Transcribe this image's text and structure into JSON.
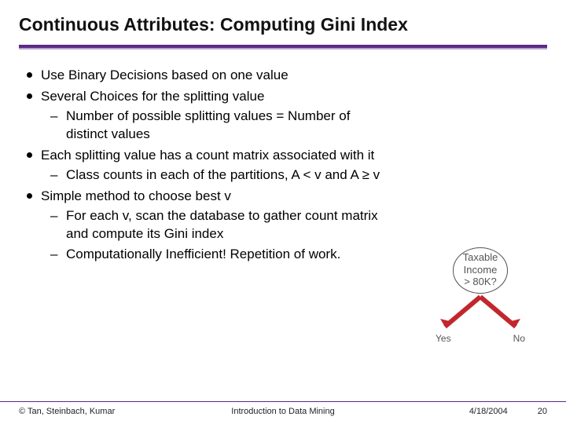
{
  "title": "Continuous Attributes: Computing Gini Index",
  "bullets": {
    "b1": "Use Binary Decisions based on one value",
    "b2": "Several Choices for the splitting value",
    "b2a": "Number of possible splitting values = Number of distinct values",
    "b3": "Each splitting value has a count matrix associated with it",
    "b3a": "Class counts in each of the partitions, A < v and A ≥ v",
    "b4": "Simple method to choose best v",
    "b4a": "For each v, scan the database to gather count matrix and compute its Gini index",
    "b4b": "Computationally Inefficient! Repetition of work."
  },
  "tree": {
    "node_line1": "Taxable",
    "node_line2": "Income",
    "node_line3": "> 80K?",
    "yes": "Yes",
    "no": "No"
  },
  "footer": {
    "left": "© Tan, Steinbach, Kumar",
    "center": "Introduction to Data Mining",
    "date": "4/18/2004",
    "page": "20"
  }
}
